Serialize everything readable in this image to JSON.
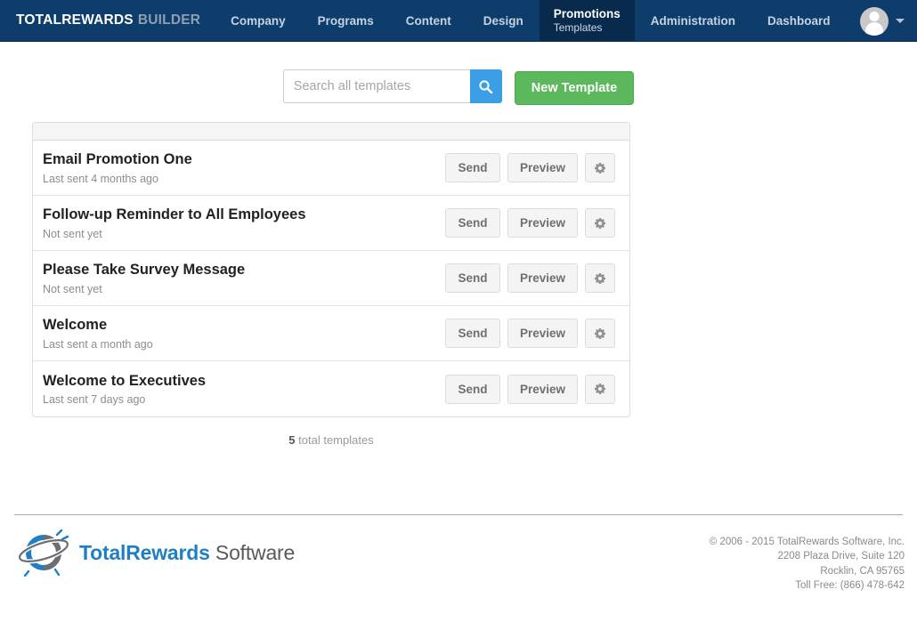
{
  "navbar": {
    "brand_strong": "TOTALREWARDS",
    "brand_light": "BUILDER",
    "items": [
      {
        "label": "Company",
        "sub": "",
        "active": false
      },
      {
        "label": "Programs",
        "sub": "",
        "active": false
      },
      {
        "label": "Content",
        "sub": "",
        "active": false
      },
      {
        "label": "Design",
        "sub": "",
        "active": false
      },
      {
        "label": "Promotions",
        "sub": "Templates",
        "active": true
      },
      {
        "label": "Administration",
        "sub": "",
        "active": false
      },
      {
        "label": "Dashboard",
        "sub": "",
        "active": false
      }
    ],
    "avatar_icon": "user-avatar-icon",
    "caret_icon": "chevron-down-icon",
    "colors": {
      "navbar_bg": "#0e3d6b",
      "active_tab_bg": "#072a4d"
    }
  },
  "toolbar": {
    "search_value": "",
    "search_placeholder": "Search all templates",
    "search_icon": "search-icon",
    "new_template_label": "New Template",
    "colors": {
      "search_button": "#3c9ee5",
      "new_button": "#5cb85c"
    }
  },
  "templates": {
    "rows": [
      {
        "title": "Email Promotion One",
        "status": "Last sent 4 months ago"
      },
      {
        "title": "Follow-up Reminder to All Employees",
        "status": "Not sent yet"
      },
      {
        "title": "Please Take Survey Message",
        "status": "Not sent yet"
      },
      {
        "title": "Welcome",
        "status": "Last sent a month ago"
      },
      {
        "title": "Welcome to Executives",
        "status": "Last sent 7 days ago"
      }
    ],
    "send_label": "Send",
    "preview_label": "Preview",
    "settings_icon": "gear-icon",
    "total_count": "5",
    "total_label": "total templates"
  },
  "footer": {
    "logo_name_blue": "TotalRewards",
    "logo_name_gray": "Software",
    "logo_icon": "totalrewards-globe-logo",
    "address_lines": [
      "© 2006 - 2015 TotalRewards Software, Inc.",
      "2208 Plaza Drive, Suite 120",
      "Rocklin, CA 95765",
      "Toll Free: (866) 478-642"
    ]
  }
}
